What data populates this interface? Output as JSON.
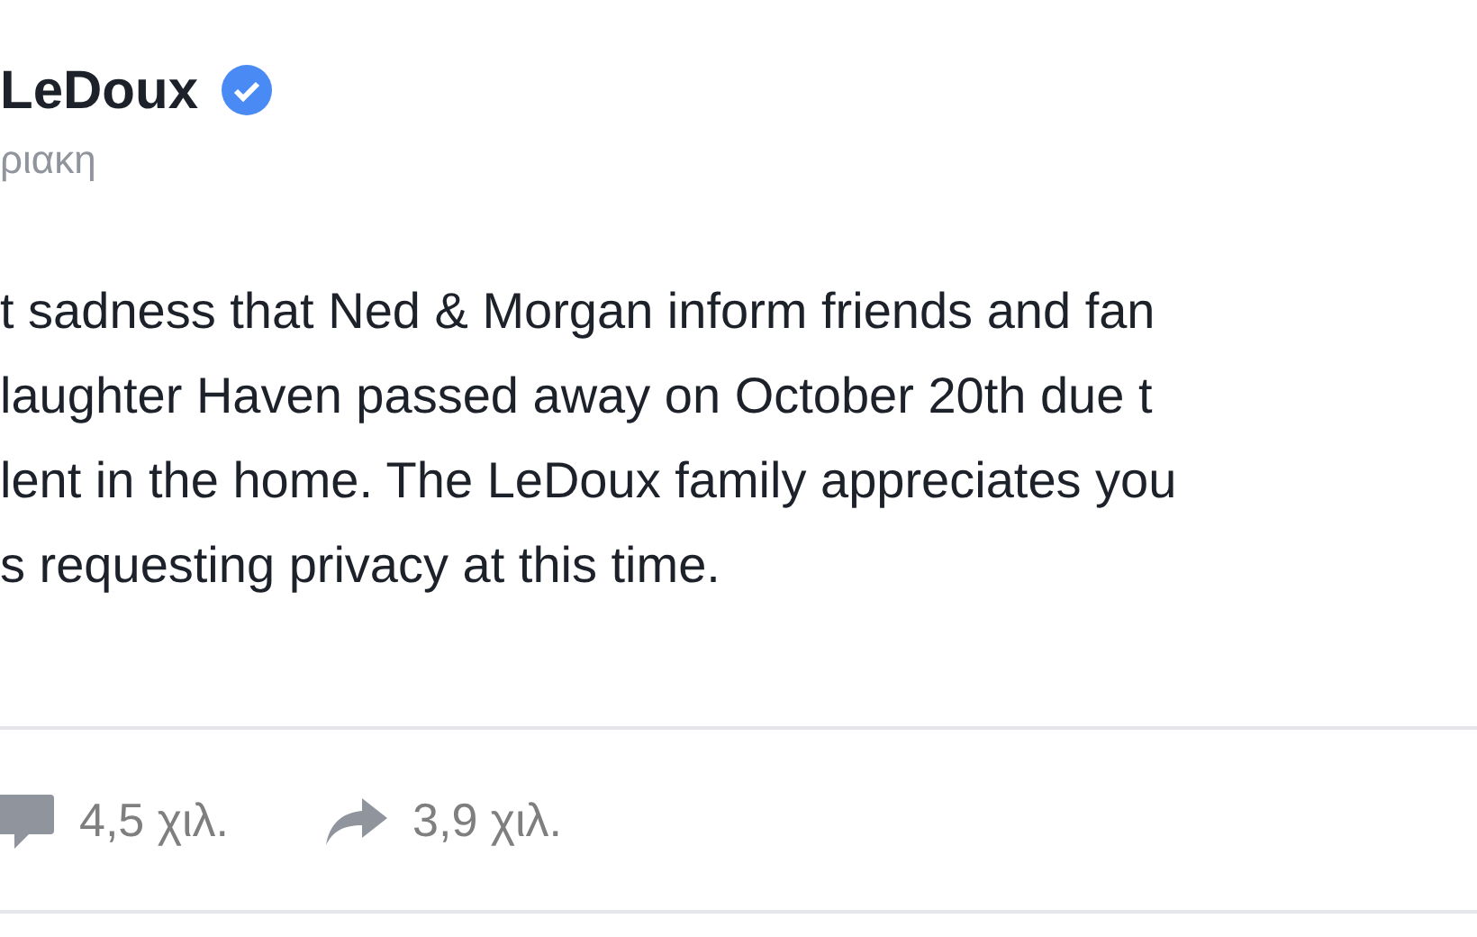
{
  "post": {
    "author": "LeDoux",
    "verified": true,
    "time": "ριακη",
    "body_lines": [
      "t sadness that Ned & Morgan inform friends and fan",
      "laughter Haven passed away on October 20th due t",
      "lent in the home. The LeDoux family appreciates you",
      "s requesting privacy at this time."
    ],
    "comments": "4,5 χιλ.",
    "shares": "3,9 χιλ."
  }
}
